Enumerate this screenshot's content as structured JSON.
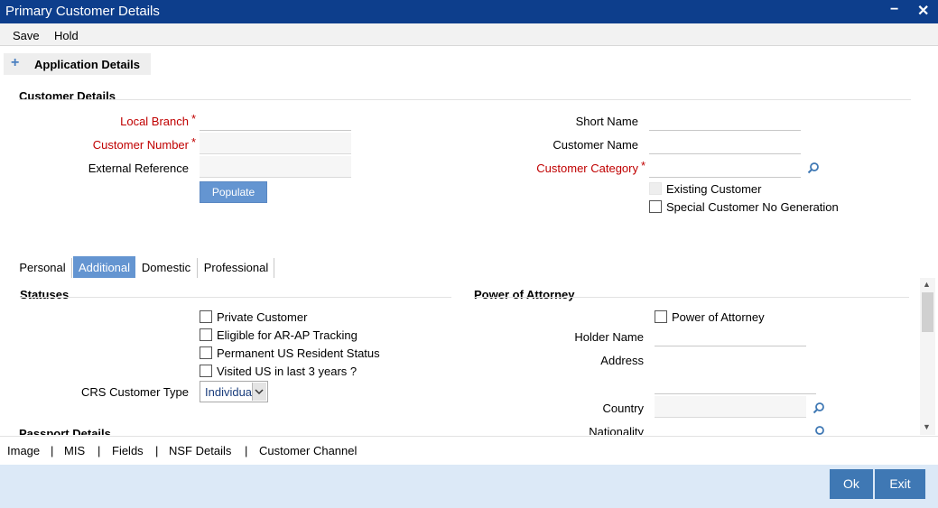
{
  "window": {
    "title": "Primary Customer Details",
    "minimize": "−",
    "close": "✕"
  },
  "menu": {
    "save": "Save",
    "hold": "Hold"
  },
  "application_details": {
    "plus": "+",
    "label": "Application Details"
  },
  "customer_details": {
    "title": "Customer Details",
    "local_branch": {
      "label": "Local Branch",
      "value": ""
    },
    "customer_number": {
      "label": "Customer Number",
      "value": ""
    },
    "external_reference": {
      "label": "External Reference",
      "value": ""
    },
    "populate_button": "Populate",
    "short_name": {
      "label": "Short Name",
      "value": ""
    },
    "customer_name": {
      "label": "Customer Name",
      "value": ""
    },
    "customer_category": {
      "label": "Customer Category",
      "value": ""
    },
    "existing_customer": {
      "label": "Existing Customer",
      "checked": false,
      "disabled": true
    },
    "special_customer_no_generation": {
      "label": "Special Customer No Generation",
      "checked": false
    },
    "required_mark": "*"
  },
  "tabs": [
    {
      "label": "Personal",
      "active": false
    },
    {
      "label": "Additional",
      "active": true
    },
    {
      "label": "Domestic",
      "active": false
    },
    {
      "label": "Professional",
      "active": false
    }
  ],
  "statuses": {
    "title": "Statuses",
    "private_customer": "Private Customer",
    "eligible_ar_ap": "Eligible for AR-AP Tracking",
    "permanent_us_resident": "Permanent US Resident Status",
    "visited_us": "Visited US in last 3 years ?",
    "crs_customer_type": {
      "label": "CRS Customer Type",
      "value": "Individual"
    }
  },
  "passport_details": {
    "title": "Passport Details"
  },
  "power_of_attorney": {
    "title": "Power of Attorney",
    "checkbox_label": "Power of Attorney",
    "holder_name": "Holder Name",
    "address": "Address",
    "country": "Country",
    "nationality": "Nationality"
  },
  "footer_links": [
    "Image",
    "MIS",
    "Fields",
    "NSF Details",
    "Customer Channel"
  ],
  "footer_separator": "|",
  "buttons": {
    "ok": "Ok",
    "exit": "Exit"
  },
  "colors": {
    "titlebar": "#0d3e8c",
    "accent": "#6495d1",
    "required": "#c00000",
    "button": "#3f78b4",
    "bottom_bar": "#dce9f7"
  }
}
